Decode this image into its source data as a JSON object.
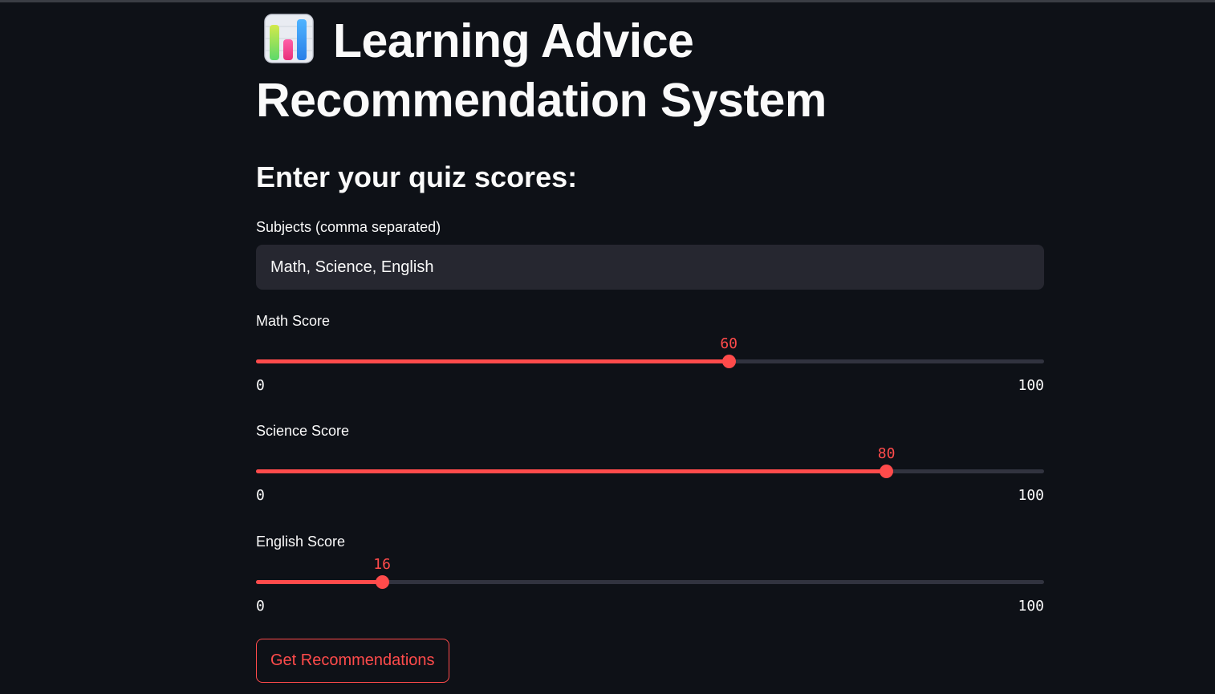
{
  "app": {
    "title": "Learning Advice Recommendation System",
    "title_icon": "bar-chart-icon"
  },
  "form": {
    "subheader": "Enter your quiz scores:",
    "subjects_label": "Subjects (comma separated)",
    "subjects_value": "Math, Science, English",
    "submit_label": "Get Recommendations"
  },
  "sliders": [
    {
      "label": "Math Score",
      "value": 60,
      "min": 0,
      "max": 100
    },
    {
      "label": "Science Score",
      "value": 80,
      "min": 0,
      "max": 100
    },
    {
      "label": "English Score",
      "value": 16,
      "min": 0,
      "max": 100
    }
  ],
  "colors": {
    "background": "#0e1117",
    "accent": "#ff4b4b",
    "input_background": "#262730",
    "track": "#31333f",
    "text": "#fafafa"
  }
}
